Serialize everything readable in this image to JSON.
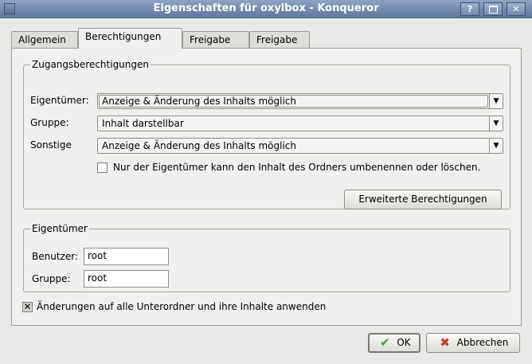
{
  "window": {
    "title": "Eigenschaften für oxylbox - Konqueror",
    "help_label": "?",
    "minimize_label": "_"
  },
  "tabs": [
    {
      "label": "Allgemein"
    },
    {
      "label": "Berechtigungen",
      "active": true
    },
    {
      "label": "Freigabe"
    },
    {
      "label": "Freigabe"
    }
  ],
  "access": {
    "legend": "Zugangsberechtigungen",
    "owner_label": "Eigentümer:",
    "owner_value": "Anzeige & Änderung des Inhalts möglich",
    "group_label": "Gruppe:",
    "group_value": "Inhalt darstellbar",
    "others_label": "Sonstige",
    "others_value": "Anzeige & Änderung des Inhalts möglich",
    "only_owner_label": "Nur der Eigentümer kann den Inhalt des Ordners umbenennen oder löschen.",
    "advanced_button": "Erweiterte Berechtigungen"
  },
  "ownership": {
    "legend": "Eigentümer",
    "user_label": "Benutzer:",
    "user_value": "root",
    "group_label": "Gruppe:",
    "group_value": "root"
  },
  "apply_recursive_label": "Änderungen auf alle Unterordner und ihre Inhalte anwenden",
  "buttons": {
    "ok": "OK",
    "cancel": "Abbrechen"
  },
  "colors": {
    "titlebar": "#6f88ad",
    "ok_icon": "#3aa52b",
    "cancel_icon": "#d03a2a"
  }
}
